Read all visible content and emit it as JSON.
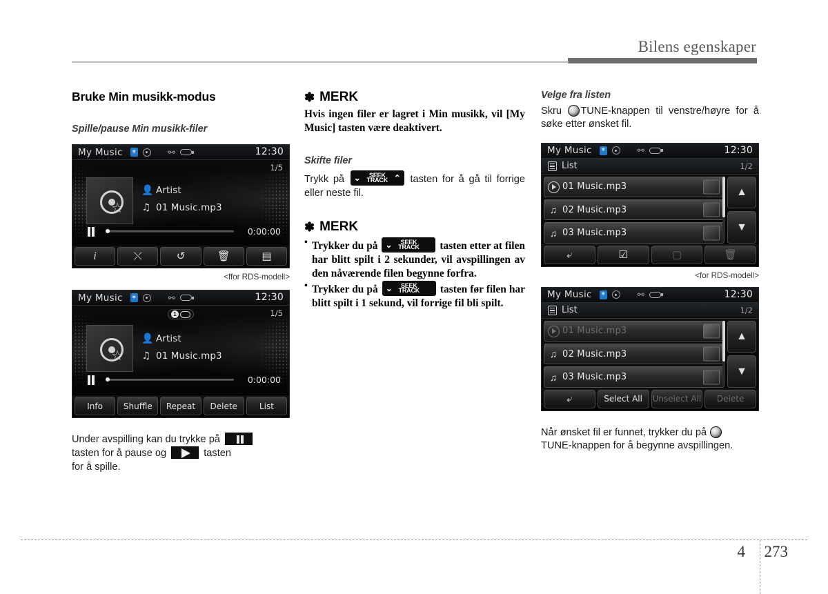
{
  "header": {
    "title": "Bilens egenskaper"
  },
  "page_footer": {
    "chapter": "4",
    "page": "273"
  },
  "col1": {
    "heading": "Bruke Min musikk-modus",
    "subheading": "Spille/pause Min musikk-filer",
    "caption1": "<ffor RDS-modell>",
    "bottom_text_1": "Under avspilling kan du trykke på",
    "bottom_text_2": "tasten for å pause og",
    "bottom_text_3": "tasten",
    "bottom_text_4": "for å spille."
  },
  "col2": {
    "note1_title": "MERK",
    "note1_body": "Hvis ingen filer er lagret i Min musikk, vil [My Music] tasten være deaktivert.",
    "subheading": "Skifte filer",
    "skifte_text_1": "Trykk på",
    "skifte_text_2": "tasten for å gå til forrige eller neste fil.",
    "note2_title": "MERK",
    "note2_b1_a": "Trykker du på",
    "note2_b1_b": "tasten etter at filen har blitt spilt i 2 sekunder, vil avspillingen av den nåværende filen begynne forfra.",
    "note2_b2_a": "Trykker du på",
    "note2_b2_b": "tasten før filen har blitt spilt i 1 sekund, vil forrige fil bli spilt.",
    "seek_key": {
      "line1": "SEEK",
      "line2": "TRACK"
    }
  },
  "col3": {
    "subheading": "Velge fra listen",
    "text_1": "Skru",
    "text_2": "TUNE-knappen til venstre/høyre for å søke etter ønsket fil.",
    "caption1": "<for RDS-modell>",
    "bottom_text_1": "Når ønsket fil er funnet, trykker du på",
    "bottom_text_2": "TUNE-knappen for å begynne avspillingen."
  },
  "device_common": {
    "title": "My Music",
    "time": "12:30",
    "icons": [
      "bluetooth-icon",
      "disc-icon",
      "usb-icon",
      "device-icon"
    ]
  },
  "screen_player_icons": {
    "track_index": "1/5",
    "artist": "Artist",
    "track": "01 Music.mp3",
    "elapsed": "0:00:00",
    "buttons": [
      {
        "name": "info-button",
        "glyph": "i"
      },
      {
        "name": "shuffle-button",
        "glyph": "⤬"
      },
      {
        "name": "repeat-button",
        "glyph": "↺"
      },
      {
        "name": "delete-button",
        "glyph": "🗑"
      },
      {
        "name": "list-button",
        "glyph": "▤"
      }
    ]
  },
  "screen_player_labels": {
    "track_index": "1/5",
    "artist": "Artist",
    "track": "01 Music.mp3",
    "elapsed": "0:00:00",
    "repeat_badge": "1",
    "buttons": [
      {
        "name": "info-button",
        "label": "Info"
      },
      {
        "name": "shuffle-button",
        "label": "Shuffle"
      },
      {
        "name": "repeat-button",
        "label": "Repeat"
      },
      {
        "name": "delete-button",
        "label": "Delete"
      },
      {
        "name": "list-button",
        "label": "List"
      }
    ]
  },
  "screen_list_icons": {
    "list_label": "List",
    "page": "1/2",
    "rows": [
      {
        "track": "01 Music.mp3",
        "icon": "play-circle-icon",
        "dimmed": false
      },
      {
        "track": "02 Music.mp3",
        "icon": "music-note-icon",
        "dimmed": false
      },
      {
        "track": "03 Music.mp3",
        "icon": "music-note-icon",
        "dimmed": false
      }
    ],
    "buttons": [
      {
        "name": "back-button",
        "glyph": "⤶"
      },
      {
        "name": "select-all-button",
        "glyph": "☑"
      },
      {
        "name": "unselect-all-button",
        "glyph": "▢"
      },
      {
        "name": "delete-button",
        "glyph": "🗑"
      }
    ],
    "scroll_up": "▲",
    "scroll_down": "▼"
  },
  "screen_list_labels": {
    "list_label": "List",
    "page": "1/2",
    "rows": [
      {
        "track": "01 Music.mp3",
        "icon": "play-circle-icon",
        "dimmed": true
      },
      {
        "track": "02 Music.mp3",
        "icon": "music-note-icon",
        "dimmed": false
      },
      {
        "track": "03 Music.mp3",
        "icon": "music-note-icon",
        "dimmed": false
      }
    ],
    "buttons": [
      {
        "name": "back-button",
        "label": "⤶",
        "dim": false
      },
      {
        "name": "select-all-button",
        "label": "Select All",
        "dim": false
      },
      {
        "name": "unselect-all-button",
        "label": "Unselect All",
        "dim": true
      },
      {
        "name": "delete-button",
        "label": "Delete",
        "dim": true
      }
    ],
    "scroll_up": "▲",
    "scroll_down": "▼"
  },
  "colors": {
    "accent_bluetooth": "#1f78c8",
    "header_rule": "#6d6e70",
    "text": "#000000"
  }
}
